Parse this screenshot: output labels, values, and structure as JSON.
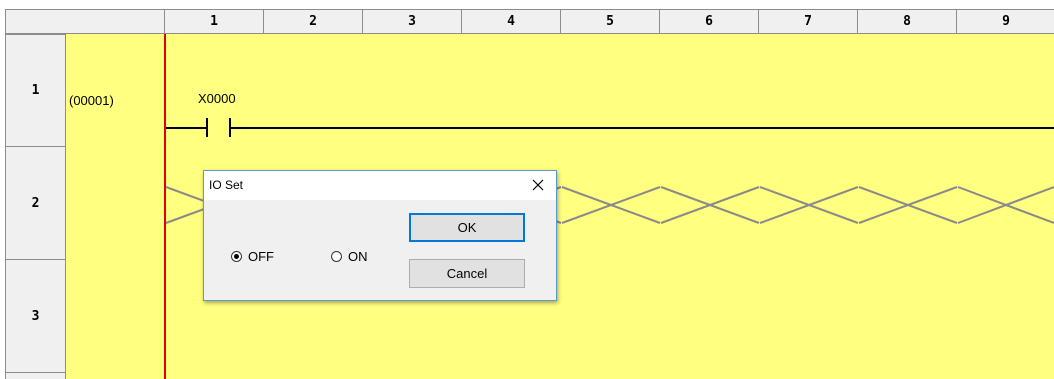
{
  "grid": {
    "columns": [
      "1",
      "2",
      "3",
      "4",
      "5",
      "6",
      "7",
      "8",
      "9"
    ],
    "rows": [
      "1",
      "2",
      "3"
    ]
  },
  "rung": {
    "step": "(00001)",
    "contact_label": "X0000"
  },
  "dialog": {
    "title": "IO Set",
    "ok_label": "OK",
    "cancel_label": "Cancel",
    "options": [
      {
        "label": "OFF",
        "selected": true
      },
      {
        "label": "ON",
        "selected": false
      }
    ]
  },
  "colors": {
    "canvas": "#ffff80",
    "power_rail": "#e00000",
    "header_bg": "#f0f0f0",
    "dialog_border": "#5b9bd5",
    "default_button_border": "#0078d7"
  }
}
